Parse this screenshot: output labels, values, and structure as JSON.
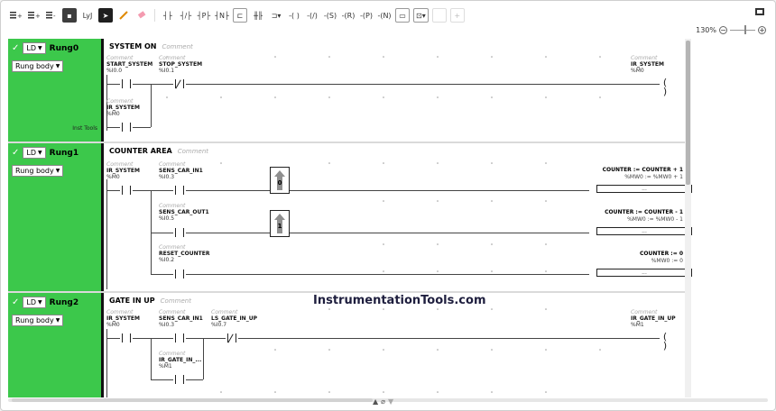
{
  "toolbar": {
    "buttons": [
      "add-rung-above-icon",
      "add-rung-below-icon",
      "add-rung-icon",
      "ld-mode-icon",
      "ly-mode-icon",
      "pointer-icon",
      "pencil-icon",
      "eraser-icon",
      "contact-no-icon",
      "contact-nc-icon",
      "contact-pos-icon",
      "contact-neg-icon",
      "compare-block-icon",
      "parallel-branch-icon",
      "function-block-icon",
      "coil-icon",
      "coil-negated-icon",
      "coil-set-icon",
      "coil-reset-icon",
      "coil-pos-icon",
      "coil-neg-icon",
      "operation-block-icon",
      "window-icon",
      "add-icon"
    ],
    "ly_label": "LyJ"
  },
  "zoom": {
    "value": "130%",
    "minus": "−",
    "plus": "+"
  },
  "rungs": [
    {
      "label": "Rung0",
      "lang": "LD",
      "body": "Rung body",
      "title": "SYSTEM ON",
      "comment": "Comment",
      "inst_tools": "Inst Tools",
      "elements": [
        {
          "comment": "Comment",
          "name": "START_SYSTEM",
          "addr": "%I0.0"
        },
        {
          "comment": "Comment",
          "name": "STOP_SYSTEM",
          "addr": "%I0.1"
        },
        {
          "comment": "Comment",
          "name": "IR_SYSTEM",
          "addr": "%M0"
        },
        {
          "comment": "Comment",
          "name": "IR_SYSTEM",
          "addr": "%M0"
        }
      ]
    },
    {
      "label": "Rung1",
      "lang": "LD",
      "body": "Rung body",
      "title": "COUNTER AREA",
      "comment": "Comment",
      "elements": [
        {
          "comment": "Comment",
          "name": "IR_SYSTEM",
          "addr": "%M0"
        },
        {
          "comment": "Comment",
          "name": "SENS_CAR_IN1",
          "addr": "%I0.3"
        },
        {
          "comment": "Comment",
          "name": "SENS_CAR_OUT1",
          "addr": "%I0.5"
        },
        {
          "comment": "Comment",
          "name": "RESET_COUNTER",
          "addr": "%I0.2"
        }
      ],
      "counters": [
        "0",
        "1"
      ],
      "ops": [
        {
          "expr": "COUNTER := COUNTER + 1",
          "addr": "%MW0 := %MW0 + 1",
          "box": "..."
        },
        {
          "expr": "COUNTER := COUNTER - 1",
          "addr": "%MW0 := %MW0 - 1",
          "box": "..."
        },
        {
          "expr": "COUNTER := 0",
          "addr": "%MW0 := 0",
          "box": "..."
        }
      ]
    },
    {
      "label": "Rung2",
      "lang": "LD",
      "body": "Rung body",
      "title": "GATE IN UP",
      "comment": "Comment",
      "elements": [
        {
          "comment": "Comment",
          "name": "IR_SYSTEM",
          "addr": "%M0"
        },
        {
          "comment": "Comment",
          "name": "SENS_CAR_IN1",
          "addr": "%I0.3"
        },
        {
          "comment": "Comment",
          "name": "LS_GATE_IN_UP",
          "addr": "%I0.7"
        },
        {
          "comment": "Comment",
          "name": "IR_GATE_IN_UP",
          "addr": "%M1"
        },
        {
          "comment": "Comment",
          "name": "IR_GATE_IN_...",
          "addr": "%M1"
        }
      ]
    }
  ],
  "watermark": "InstrumentationTools.com"
}
